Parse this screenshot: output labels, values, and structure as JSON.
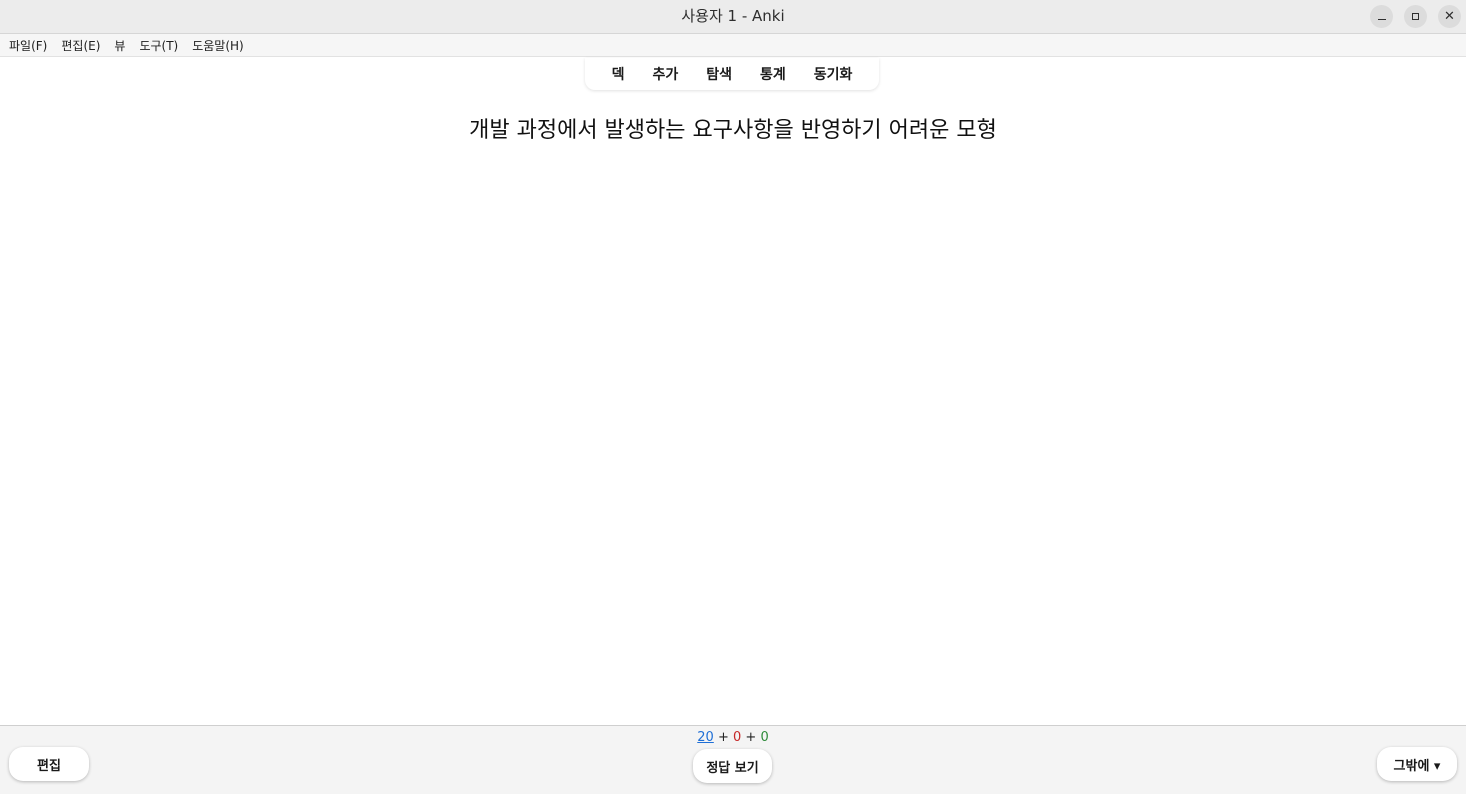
{
  "window": {
    "title": "사용자 1 - Anki",
    "controls": {
      "minimize_icon": "minimize-icon",
      "maximize_icon": "maximize-icon",
      "close_label": "✕"
    }
  },
  "menubar": {
    "items": [
      {
        "label": "파일(F)"
      },
      {
        "label": "편집(E)"
      },
      {
        "label": "뷰"
      },
      {
        "label": "도구(T)"
      },
      {
        "label": "도움말(H)"
      }
    ]
  },
  "toolbar": {
    "tabs": [
      {
        "label": "덱"
      },
      {
        "label": "추가"
      },
      {
        "label": "탐색"
      },
      {
        "label": "통계"
      },
      {
        "label": "동기화"
      }
    ]
  },
  "card": {
    "question": "개발 과정에서 발생하는 요구사항을 반영하기 어려운 모형"
  },
  "bottom": {
    "counts": {
      "new": "20",
      "sep1": " + ",
      "learn": "0",
      "sep2": " + ",
      "review": "0"
    },
    "edit_label": "편집",
    "show_answer_label": "정답 보기",
    "more_label": "그밖에 ▾"
  },
  "colors": {
    "new_count": "#1f6fd6",
    "learn_count": "#c62828",
    "review_count": "#2e8b3a"
  }
}
